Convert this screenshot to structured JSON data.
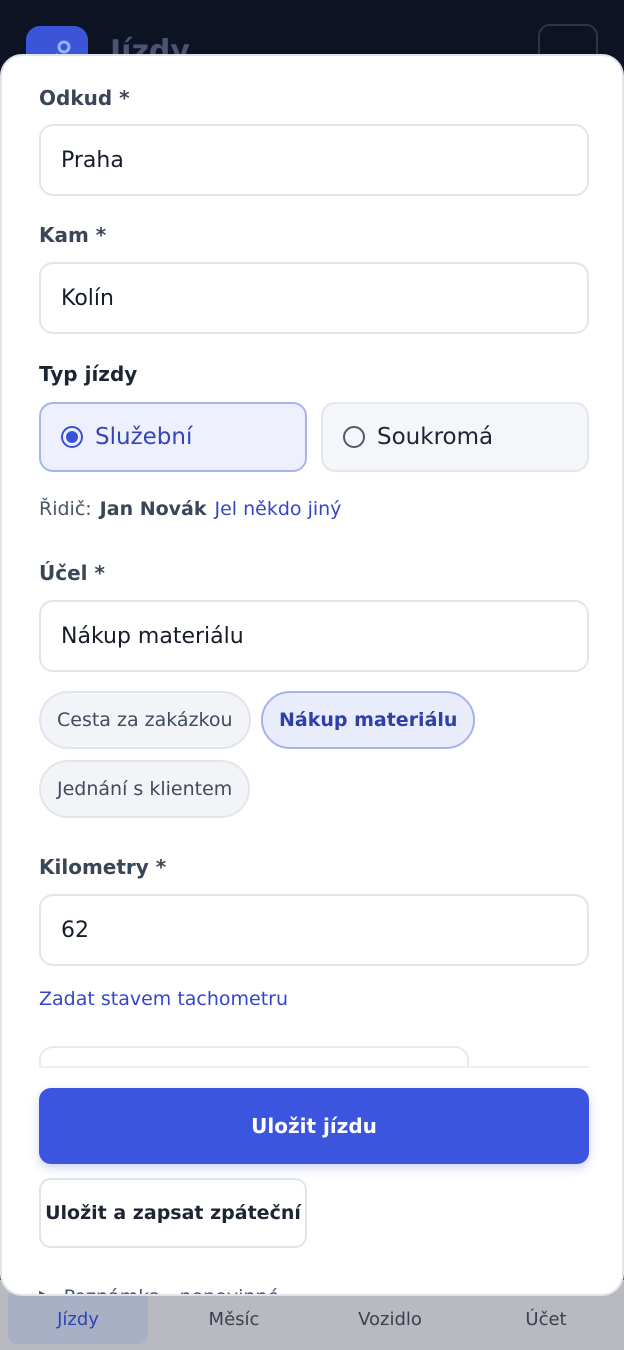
{
  "app": {
    "title": "Jízdy"
  },
  "form": {
    "from": {
      "label": "Odkud *",
      "value": "Praha"
    },
    "to": {
      "label": "Kam *",
      "value": "Kolín"
    },
    "trip_type": {
      "label": "Typ jízdy",
      "options": [
        {
          "label": "Služební",
          "selected": true
        },
        {
          "label": "Soukromá",
          "selected": false
        }
      ]
    },
    "driver": {
      "prefix": "Řidič:",
      "name": "Jan Novák",
      "change_link": "Jel někdo jiný"
    },
    "purpose": {
      "label": "Účel *",
      "value": "Nákup materiálu",
      "chips": [
        {
          "label": "Cesta za zakázkou",
          "active": false
        },
        {
          "label": "Nákup materiálu",
          "active": true
        },
        {
          "label": "Jednání s klientem",
          "active": false
        }
      ]
    },
    "km": {
      "label": "Kilometry *",
      "value": "62",
      "tacho_link": "Zadat stavem tachometru"
    },
    "notes_toggle": "Poznámka - nepovinné"
  },
  "actions": {
    "save": "Uložit jízdu",
    "save_return": "Uložit a zapsat zpáteční"
  },
  "nav": {
    "items": [
      "Jízdy",
      "Měsíc",
      "Vozidlo",
      "Účet"
    ]
  },
  "colors": {
    "accent": "#3b55df",
    "overlay": "#0f1526"
  }
}
